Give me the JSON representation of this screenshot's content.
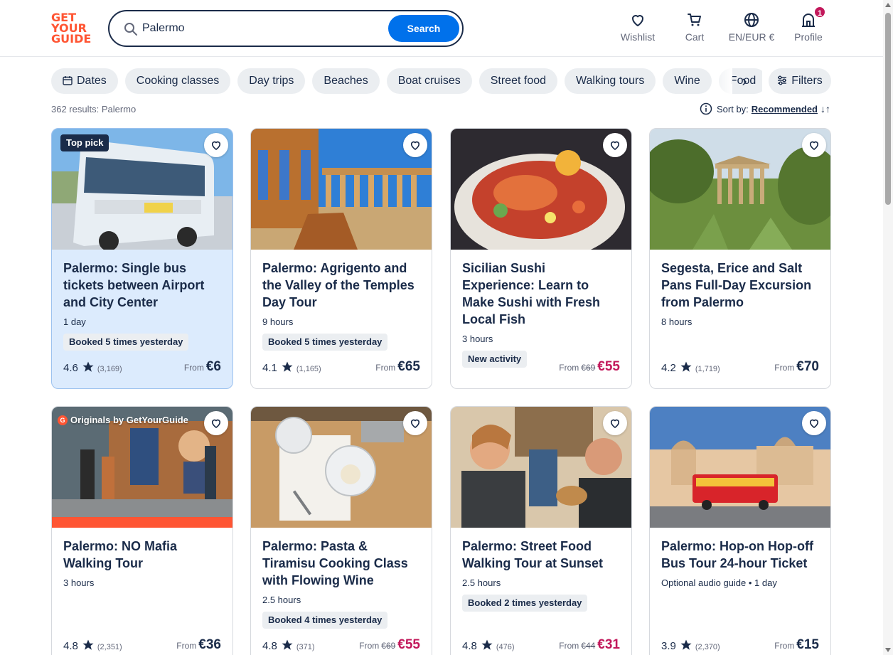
{
  "header": {
    "logo_lines": [
      "GET",
      "YOUR",
      "GUIDE"
    ],
    "search_value": "Palermo",
    "search_button": "Search",
    "wishlist": "Wishlist",
    "cart": "Cart",
    "language": "EN/EUR €",
    "profile": "Profile",
    "profile_badge": "1"
  },
  "chips": {
    "dates": "Dates",
    "items": [
      "Cooking classes",
      "Day trips",
      "Beaches",
      "Boat cruises",
      "Street food",
      "Walking tours",
      "Wine",
      "Food"
    ],
    "filters": "Filters"
  },
  "results_text": "362 results: Palermo",
  "sort": {
    "label": "Sort by:",
    "value": "Recommended"
  },
  "cards": [
    {
      "title": "Palermo: Single bus tickets between Airport and City Center",
      "meta": "1 day",
      "badge": "Booked 5 times yesterday",
      "tag": "Top pick",
      "rating": "4.6",
      "reviews": "(3,169)",
      "from": "From",
      "old_price": "",
      "price": "€6",
      "sale": false
    },
    {
      "title": "Palermo: Agrigento and the Valley of the Temples Day Tour",
      "meta": "9 hours",
      "badge": "Booked 5 times yesterday",
      "tag": "",
      "rating": "4.1",
      "reviews": "(1,165)",
      "from": "From",
      "old_price": "",
      "price": "€65",
      "sale": false
    },
    {
      "title": "Sicilian Sushi Experience: Learn to Make Sushi with Fresh Local Fish",
      "meta": "3 hours",
      "badge": "New activity",
      "tag": "",
      "rating": "",
      "reviews": "",
      "from": "From",
      "old_price": "€69",
      "price": "€55",
      "sale": true
    },
    {
      "title": "Segesta, Erice and Salt Pans Full-Day Excursion from Palermo",
      "meta": "8 hours",
      "badge": "",
      "tag": "",
      "rating": "4.2",
      "reviews": "(1,719)",
      "from": "From",
      "old_price": "",
      "price": "€70",
      "sale": false
    },
    {
      "title": "Palermo: NO Mafia Walking Tour",
      "meta": "3 hours",
      "badge": "",
      "tag": "Originals by GetYourGuide",
      "tag_logo": "G",
      "rating": "4.8",
      "reviews": "(2,351)",
      "from": "From",
      "old_price": "",
      "price": "€36",
      "sale": false
    },
    {
      "title": "Palermo: Pasta & Tiramisu Cooking Class with Flowing Wine",
      "meta": "2.5 hours",
      "badge": "Booked 4 times yesterday",
      "tag": "",
      "rating": "4.8",
      "reviews": "(371)",
      "from": "From",
      "old_price": "€69",
      "price": "€55",
      "sale": true
    },
    {
      "title": "Palermo: Street Food Walking Tour at Sunset",
      "meta": "2.5 hours",
      "badge": "Booked 2 times yesterday",
      "tag": "",
      "rating": "4.8",
      "reviews": "(476)",
      "from": "From",
      "old_price": "€44",
      "price": "€31",
      "sale": true
    },
    {
      "title": "Palermo: Hop-on Hop-off Bus Tour 24-hour Ticket",
      "meta": "Optional audio guide • 1 day",
      "badge": "",
      "tag": "",
      "rating": "3.9",
      "reviews": "(2,370)",
      "from": "From",
      "old_price": "",
      "price": "€15",
      "sale": false
    }
  ],
  "colors": {
    "brand": "#ff5533",
    "primary": "#0071eb",
    "text": "#1a2b49",
    "sale": "#c2185b",
    "highlight": "#dcebfd"
  },
  "icons": [
    "search-icon",
    "heart-icon",
    "cart-icon",
    "globe-icon",
    "profile-icon",
    "calendar-icon",
    "chevron-right-icon",
    "filters-icon",
    "info-icon",
    "star-icon",
    "sort-icon"
  ]
}
